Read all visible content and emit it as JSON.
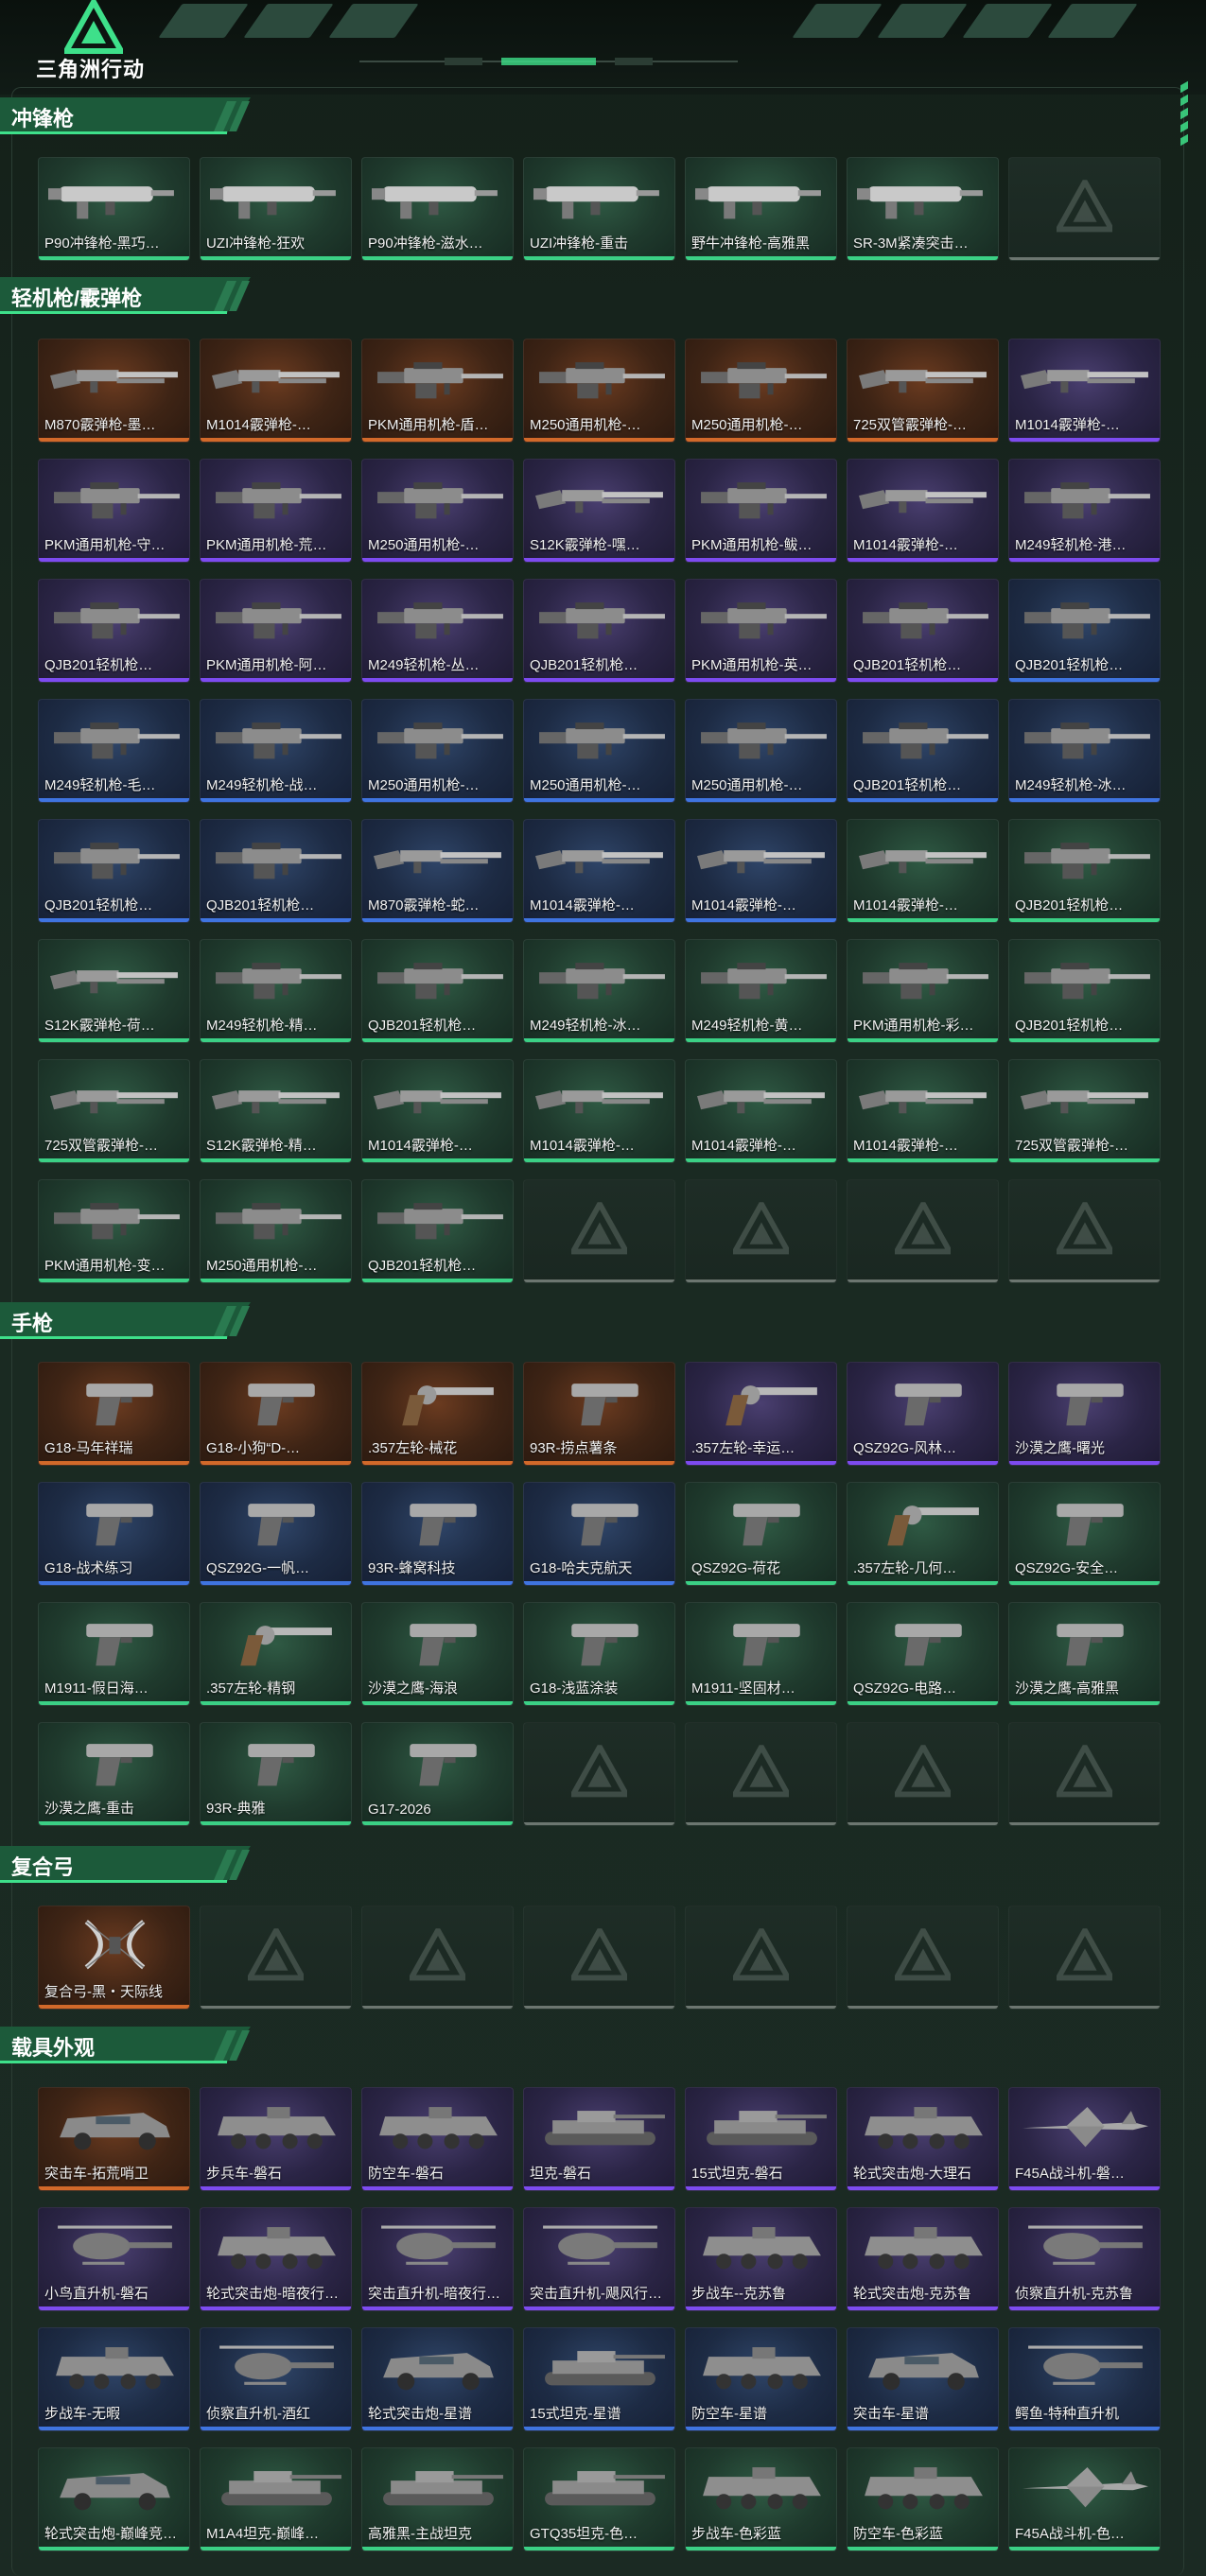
{
  "header": {
    "logo_text": "三角洲行动",
    "accent_color": "#3ee08a"
  },
  "sections": [
    {
      "id": "smg",
      "title": "冲锋枪",
      "items": [
        {
          "name": "P90冲锋枪-黑巧…",
          "rarity": "green",
          "type": "smg"
        },
        {
          "name": "UZI冲锋枪-狂欢",
          "rarity": "green",
          "type": "smg"
        },
        {
          "name": "P90冲锋枪-滋水…",
          "rarity": "green",
          "type": "smg"
        },
        {
          "name": "UZI冲锋枪-重击",
          "rarity": "green",
          "type": "smg"
        },
        {
          "name": "野牛冲锋枪-高雅黑",
          "rarity": "green",
          "type": "smg"
        },
        {
          "name": "SR-3M紧凑突击…",
          "rarity": "green",
          "type": "smg"
        },
        {
          "name": "",
          "rarity": "empty",
          "type": "empty"
        }
      ]
    },
    {
      "id": "lmg",
      "title": "轻机枪/霰弹枪",
      "items": [
        {
          "name": "M870霰弹枪-墨…",
          "rarity": "gold",
          "type": "shotgun"
        },
        {
          "name": "M1014霰弹枪-…",
          "rarity": "gold",
          "type": "shotgun"
        },
        {
          "name": "PKM通用机枪-盾…",
          "rarity": "gold",
          "type": "lmg"
        },
        {
          "name": "M250通用机枪-…",
          "rarity": "gold",
          "type": "lmg"
        },
        {
          "name": "M250通用机枪-…",
          "rarity": "gold",
          "type": "lmg"
        },
        {
          "name": "725双管霰弹枪-…",
          "rarity": "gold",
          "type": "shotgun"
        },
        {
          "name": "M1014霰弹枪-…",
          "rarity": "purple",
          "type": "shotgun"
        },
        {
          "name": "PKM通用机枪-守…",
          "rarity": "purple",
          "type": "lmg"
        },
        {
          "name": "PKM通用机枪-荒…",
          "rarity": "purple",
          "type": "lmg"
        },
        {
          "name": "M250通用机枪-…",
          "rarity": "purple",
          "type": "lmg"
        },
        {
          "name": "S12K霰弹枪-嘿…",
          "rarity": "purple",
          "type": "shotgun"
        },
        {
          "name": "PKM通用机枪-鲅…",
          "rarity": "purple",
          "type": "lmg"
        },
        {
          "name": "M1014霰弹枪-…",
          "rarity": "purple",
          "type": "shotgun"
        },
        {
          "name": "M249轻机枪-港…",
          "rarity": "purple",
          "type": "lmg"
        },
        {
          "name": "QJB201轻机枪…",
          "rarity": "purple",
          "type": "lmg"
        },
        {
          "name": "PKM通用机枪-阿…",
          "rarity": "purple",
          "type": "lmg"
        },
        {
          "name": "M249轻机枪-丛…",
          "rarity": "purple",
          "type": "lmg"
        },
        {
          "name": "QJB201轻机枪…",
          "rarity": "purple",
          "type": "lmg"
        },
        {
          "name": "PKM通用机枪-英…",
          "rarity": "purple",
          "type": "lmg"
        },
        {
          "name": "QJB201轻机枪…",
          "rarity": "purple",
          "type": "lmg"
        },
        {
          "name": "QJB201轻机枪…",
          "rarity": "blue",
          "type": "lmg"
        },
        {
          "name": "M249轻机枪-毛…",
          "rarity": "blue",
          "type": "lmg"
        },
        {
          "name": "M249轻机枪-战…",
          "rarity": "blue",
          "type": "lmg"
        },
        {
          "name": "M250通用机枪-…",
          "rarity": "blue",
          "type": "lmg"
        },
        {
          "name": "M250通用机枪-…",
          "rarity": "blue",
          "type": "lmg"
        },
        {
          "name": "M250通用机枪-…",
          "rarity": "blue",
          "type": "lmg"
        },
        {
          "name": "QJB201轻机枪…",
          "rarity": "blue",
          "type": "lmg"
        },
        {
          "name": "M249轻机枪-冰…",
          "rarity": "blue",
          "type": "lmg"
        },
        {
          "name": "QJB201轻机枪…",
          "rarity": "blue",
          "type": "lmg"
        },
        {
          "name": "QJB201轻机枪…",
          "rarity": "blue",
          "type": "lmg"
        },
        {
          "name": "M870霰弹枪-蛇…",
          "rarity": "blue",
          "type": "shotgun"
        },
        {
          "name": "M1014霰弹枪-…",
          "rarity": "blue",
          "type": "shotgun"
        },
        {
          "name": "M1014霰弹枪-…",
          "rarity": "blue",
          "type": "shotgun"
        },
        {
          "name": "M1014霰弹枪-…",
          "rarity": "green",
          "type": "shotgun"
        },
        {
          "name": "QJB201轻机枪…",
          "rarity": "green",
          "type": "lmg"
        },
        {
          "name": "S12K霰弹枪-荷…",
          "rarity": "green",
          "type": "shotgun"
        },
        {
          "name": "M249轻机枪-精…",
          "rarity": "green",
          "type": "lmg"
        },
        {
          "name": "QJB201轻机枪…",
          "rarity": "green",
          "type": "lmg"
        },
        {
          "name": "M249轻机枪-冰…",
          "rarity": "green",
          "type": "lmg"
        },
        {
          "name": "M249轻机枪-黄…",
          "rarity": "green",
          "type": "lmg"
        },
        {
          "name": "PKM通用机枪-彩…",
          "rarity": "green",
          "type": "lmg"
        },
        {
          "name": "QJB201轻机枪…",
          "rarity": "green",
          "type": "lmg"
        },
        {
          "name": "725双管霰弹枪-…",
          "rarity": "green",
          "type": "shotgun"
        },
        {
          "name": "S12K霰弹枪-精…",
          "rarity": "green",
          "type": "shotgun"
        },
        {
          "name": "M1014霰弹枪-…",
          "rarity": "green",
          "type": "shotgun"
        },
        {
          "name": "M1014霰弹枪-…",
          "rarity": "green",
          "type": "shotgun"
        },
        {
          "name": "M1014霰弹枪-…",
          "rarity": "green",
          "type": "shotgun"
        },
        {
          "name": "M1014霰弹枪-…",
          "rarity": "green",
          "type": "shotgun"
        },
        {
          "name": "725双管霰弹枪-…",
          "rarity": "green",
          "type": "shotgun"
        },
        {
          "name": "PKM通用机枪-变…",
          "rarity": "green",
          "type": "lmg"
        },
        {
          "name": "M250通用机枪-…",
          "rarity": "green",
          "type": "lmg"
        },
        {
          "name": "QJB201轻机枪…",
          "rarity": "green",
          "type": "lmg"
        },
        {
          "name": "",
          "rarity": "empty",
          "type": "empty"
        },
        {
          "name": "",
          "rarity": "empty",
          "type": "empty"
        },
        {
          "name": "",
          "rarity": "empty",
          "type": "empty"
        },
        {
          "name": "",
          "rarity": "empty",
          "type": "empty"
        }
      ]
    },
    {
      "id": "pistol",
      "title": "手枪",
      "items": [
        {
          "name": "G18-马年祥瑞",
          "rarity": "gold",
          "type": "pistol"
        },
        {
          "name": "G18-小狗“D-…",
          "rarity": "gold",
          "type": "pistol"
        },
        {
          "name": ".357左轮-械花",
          "rarity": "gold",
          "type": "revolver"
        },
        {
          "name": "93R-捞点薯条",
          "rarity": "gold",
          "type": "pistol"
        },
        {
          "name": ".357左轮-幸运…",
          "rarity": "purple",
          "type": "revolver"
        },
        {
          "name": "QSZ92G-风林…",
          "rarity": "purple",
          "type": "pistol"
        },
        {
          "name": "沙漠之鹰-曙光",
          "rarity": "purple",
          "type": "pistol"
        },
        {
          "name": "G18-战术练习",
          "rarity": "blue",
          "type": "pistol"
        },
        {
          "name": "QSZ92G-一帆…",
          "rarity": "blue",
          "type": "pistol"
        },
        {
          "name": "93R-蜂窝科技",
          "rarity": "blue",
          "type": "pistol"
        },
        {
          "name": "G18-哈夫克航天",
          "rarity": "blue",
          "type": "pistol"
        },
        {
          "name": "QSZ92G-荷花",
          "rarity": "green",
          "type": "pistol"
        },
        {
          "name": ".357左轮-几何…",
          "rarity": "green",
          "type": "revolver"
        },
        {
          "name": "QSZ92G-安全…",
          "rarity": "green",
          "type": "pistol"
        },
        {
          "name": "M1911-假日海…",
          "rarity": "green",
          "type": "pistol"
        },
        {
          "name": ".357左轮-精钢",
          "rarity": "green",
          "type": "revolver"
        },
        {
          "name": "沙漠之鹰-海浪",
          "rarity": "green",
          "type": "pistol"
        },
        {
          "name": "G18-浅蓝涂装",
          "rarity": "green",
          "type": "pistol"
        },
        {
          "name": "M1911-坚固材…",
          "rarity": "green",
          "type": "pistol"
        },
        {
          "name": "QSZ92G-电路…",
          "rarity": "green",
          "type": "pistol"
        },
        {
          "name": "沙漠之鹰-高雅黑",
          "rarity": "green",
          "type": "pistol"
        },
        {
          "name": "沙漠之鹰-重击",
          "rarity": "green",
          "type": "pistol"
        },
        {
          "name": "93R-典雅",
          "rarity": "green",
          "type": "pistol"
        },
        {
          "name": "G17-2026",
          "rarity": "green",
          "type": "pistol"
        },
        {
          "name": "",
          "rarity": "empty",
          "type": "empty"
        },
        {
          "name": "",
          "rarity": "empty",
          "type": "empty"
        },
        {
          "name": "",
          "rarity": "empty",
          "type": "empty"
        },
        {
          "name": "",
          "rarity": "empty",
          "type": "empty"
        }
      ]
    },
    {
      "id": "bow",
      "title": "复合弓",
      "items": [
        {
          "name": "复合弓-黑・天际线",
          "rarity": "gold",
          "type": "bow"
        },
        {
          "name": "",
          "rarity": "empty",
          "type": "empty"
        },
        {
          "name": "",
          "rarity": "empty",
          "type": "empty"
        },
        {
          "name": "",
          "rarity": "empty",
          "type": "empty"
        },
        {
          "name": "",
          "rarity": "empty",
          "type": "empty"
        },
        {
          "name": "",
          "rarity": "empty",
          "type": "empty"
        },
        {
          "name": "",
          "rarity": "empty",
          "type": "empty"
        }
      ]
    },
    {
      "id": "vehicle",
      "title": "载具外观",
      "items": [
        {
          "name": "突击车-拓荒哨卫",
          "rarity": "gold",
          "type": "car"
        },
        {
          "name": "步兵车-磐石",
          "rarity": "purple",
          "type": "apc"
        },
        {
          "name": "防空车-磐石",
          "rarity": "purple",
          "type": "apc"
        },
        {
          "name": "坦克-磐石",
          "rarity": "purple",
          "type": "tank"
        },
        {
          "name": "15式坦克-磐石",
          "rarity": "purple",
          "type": "tank"
        },
        {
          "name": "轮式突击炮-大理石",
          "rarity": "purple",
          "type": "apc"
        },
        {
          "name": "F45A战斗机-磐…",
          "rarity": "purple",
          "type": "jet"
        },
        {
          "name": "小鸟直升机-磐石",
          "rarity": "purple",
          "type": "heli"
        },
        {
          "name": "轮式突击炮-暗夜行…",
          "rarity": "purple",
          "type": "apc"
        },
        {
          "name": "突击直升机-暗夜行…",
          "rarity": "purple",
          "type": "heli"
        },
        {
          "name": "突击直升机-飓风行…",
          "rarity": "purple",
          "type": "heli"
        },
        {
          "name": "步战车--克苏鲁",
          "rarity": "purple",
          "type": "apc"
        },
        {
          "name": "轮式突击炮-克苏鲁",
          "rarity": "purple",
          "type": "apc"
        },
        {
          "name": "侦察直升机-克苏鲁",
          "rarity": "purple",
          "type": "heli"
        },
        {
          "name": "步战车-无暇",
          "rarity": "blue",
          "type": "apc"
        },
        {
          "name": "侦察直升机-酒红",
          "rarity": "blue",
          "type": "heli"
        },
        {
          "name": "轮式突击炮-星谱",
          "rarity": "blue",
          "type": "car"
        },
        {
          "name": "15式坦克-星谱",
          "rarity": "blue",
          "type": "tank"
        },
        {
          "name": "防空车-星谱",
          "rarity": "blue",
          "type": "apc"
        },
        {
          "name": "突击车-星谱",
          "rarity": "blue",
          "type": "car"
        },
        {
          "name": "鳄鱼-特种直升机",
          "rarity": "blue",
          "type": "heli"
        },
        {
          "name": "轮式突击炮-巅峰竞…",
          "rarity": "green",
          "type": "car"
        },
        {
          "name": "M1A4坦克-巅峰…",
          "rarity": "green",
          "type": "tank"
        },
        {
          "name": "高雅黑-主战坦克",
          "rarity": "green",
          "type": "tank"
        },
        {
          "name": "GTQ35坦克-色…",
          "rarity": "green",
          "type": "tank"
        },
        {
          "name": "步战车-色彩蓝",
          "rarity": "green",
          "type": "apc"
        },
        {
          "name": "防空车-色彩蓝",
          "rarity": "green",
          "type": "apc"
        },
        {
          "name": "F45A战斗机-色…",
          "rarity": "green",
          "type": "jet"
        }
      ]
    }
  ]
}
